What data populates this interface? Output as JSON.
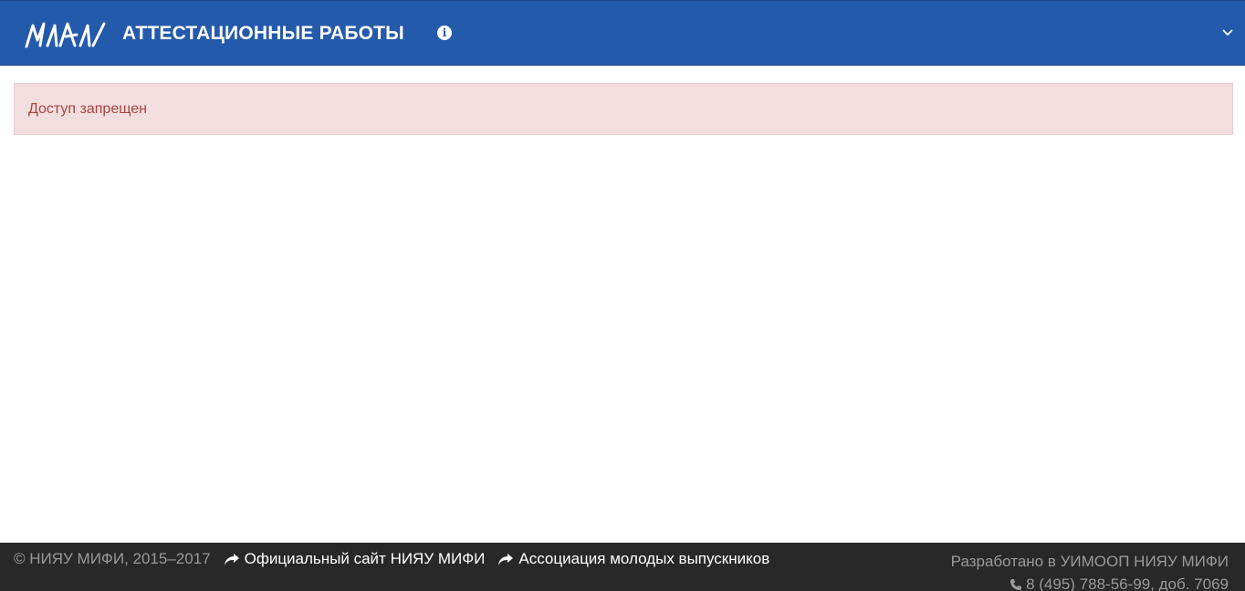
{
  "header": {
    "logo_text": "МИФИ",
    "title": "АТТЕСТАЦИОННЫЕ РАБОТЫ",
    "info_icon": "info-circle-icon",
    "toggle_icon": "chevron-down-icon"
  },
  "alert": {
    "message": "Доступ запрещен"
  },
  "footer": {
    "copyright": "© НИЯУ МИФИ, 2015–2017",
    "links": [
      {
        "label": "Официальный сайт НИЯУ МИФИ",
        "icon": "share-arrow-icon"
      },
      {
        "label": "Ассоциация молодых выпускников",
        "icon": "share-arrow-icon"
      }
    ],
    "developer": "Разработано в УИМООП НИЯУ МИФИ",
    "phone": "8 (495) 788-56-99, доб. 7069",
    "phone_icon": "phone-icon"
  },
  "colors": {
    "navbar": "#245aab",
    "alert_bg": "#f2dede",
    "alert_text": "#a94442",
    "footer_bg": "#282828"
  }
}
